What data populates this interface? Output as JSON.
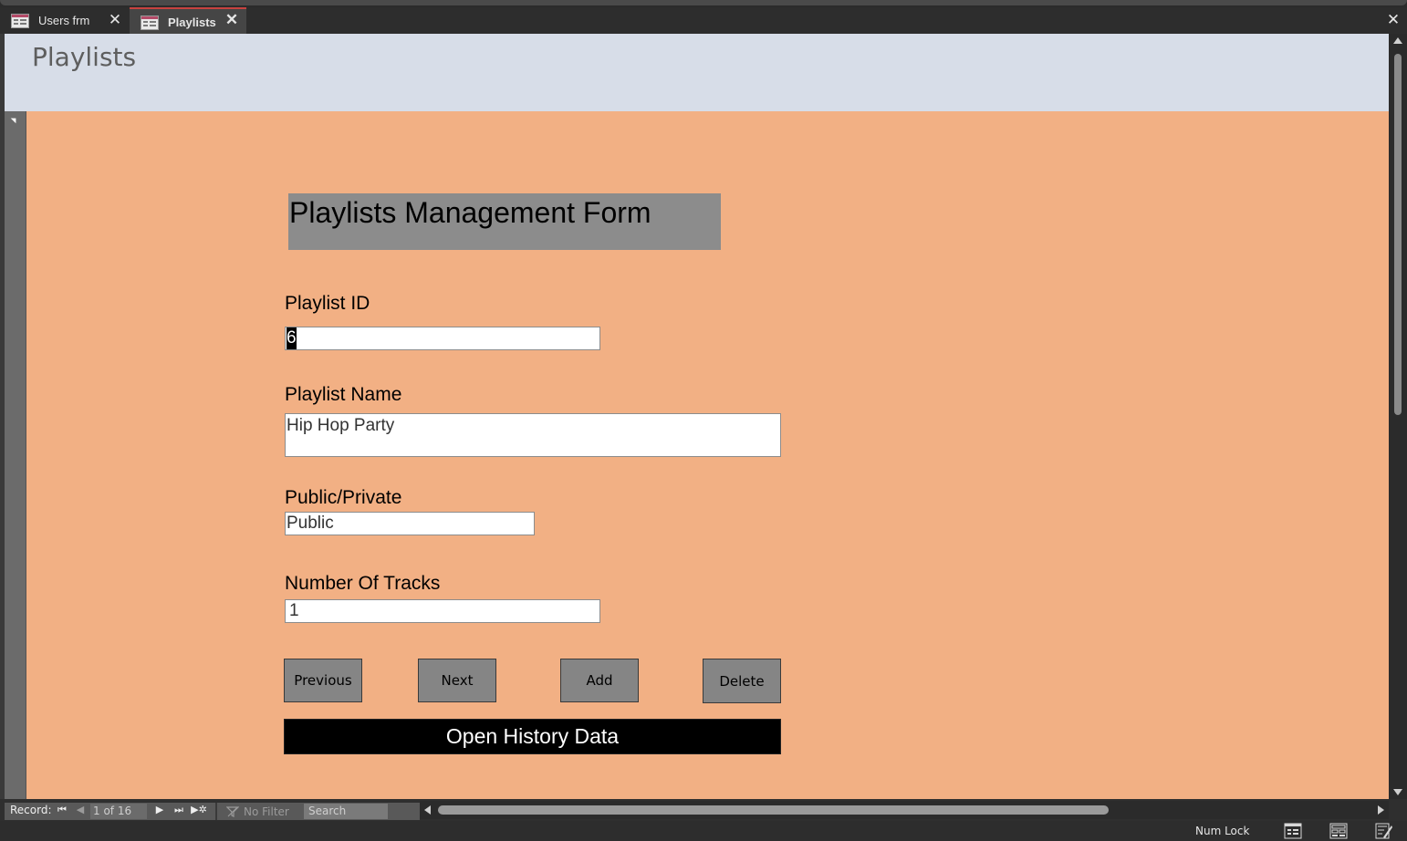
{
  "tabs": [
    {
      "label": "Users frm",
      "active": false,
      "icon": "form-icon"
    },
    {
      "label": "Playlists",
      "active": true,
      "icon": "form-icon"
    }
  ],
  "header": {
    "title": "Playlists"
  },
  "form": {
    "heading": "Playlists Management Form",
    "fields": {
      "playlist_id": {
        "label": "Playlist ID",
        "value": "6"
      },
      "playlist_name": {
        "label": "Playlist Name",
        "value": "Hip Hop Party"
      },
      "public_private": {
        "label": "Public/Private",
        "value": "Public"
      },
      "number_of_tracks": {
        "label": "Number Of Tracks",
        "value": "1"
      }
    },
    "buttons": {
      "previous": "Previous",
      "next": "Next",
      "add": "Add",
      "delete": "Delete",
      "open_history": "Open History Data"
    }
  },
  "navigation": {
    "record_label": "Record:",
    "current": "1 of 16",
    "filter": "No Filter",
    "search_placeholder": "Search"
  },
  "status": {
    "num_lock": "Num Lock"
  },
  "colors": {
    "detail_bg": "#f2b084",
    "header_bg": "#d7dde8",
    "button_bg": "#858585",
    "history_button_bg": "#000000",
    "active_tab_accent": "#c8423f"
  },
  "icons": [
    "form-icon",
    "close-icon",
    "first-record-icon",
    "previous-record-icon",
    "next-record-icon",
    "last-record-icon",
    "new-record-icon",
    "filter-icon",
    "form-view-icon",
    "layout-view-icon",
    "design-view-icon"
  ]
}
